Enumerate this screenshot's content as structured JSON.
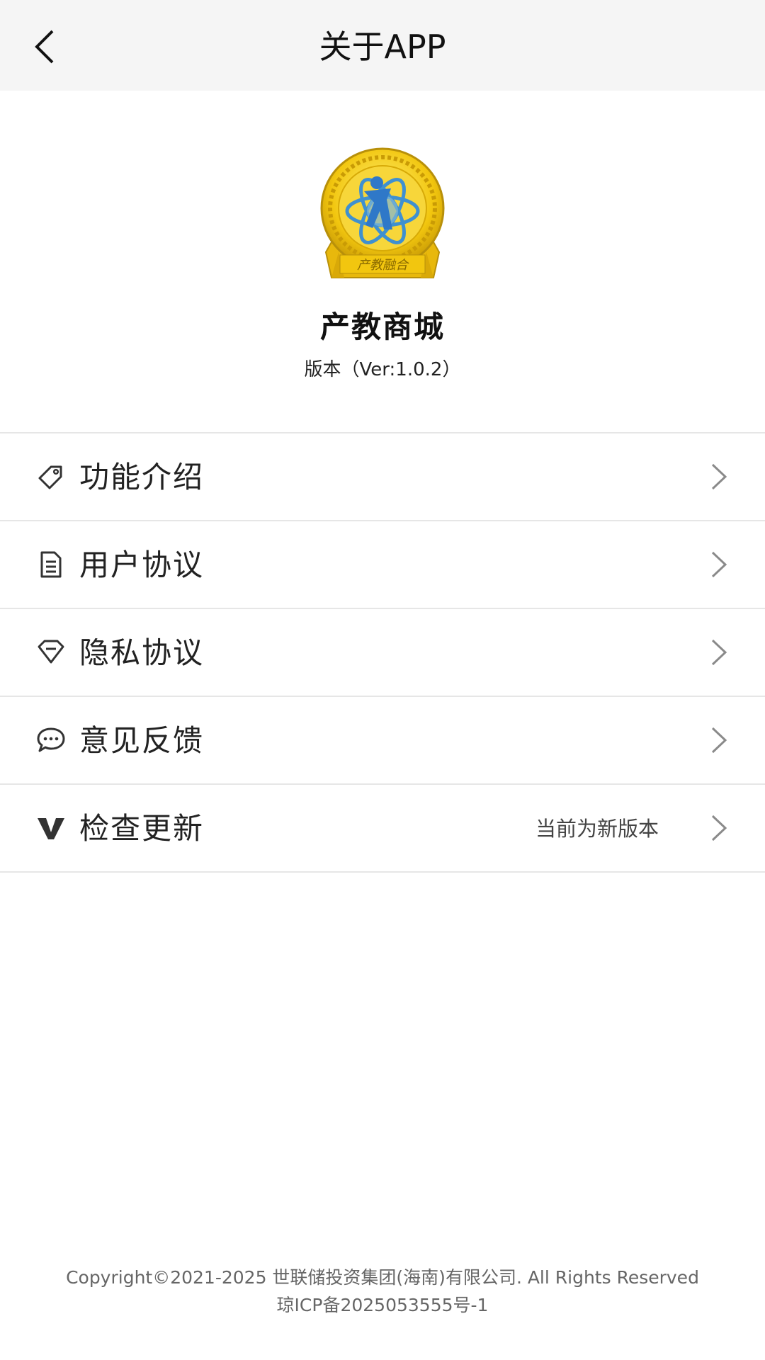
{
  "header": {
    "title": "关于APP",
    "back_icon": "chevron-left-icon"
  },
  "app": {
    "name": "产教商城",
    "version": "版本（Ver:1.0.2）",
    "logo": {
      "text": "产教融合",
      "colors": {
        "gold": "#f2c60f",
        "blue": "#2f78c8"
      }
    }
  },
  "menu": {
    "items": [
      {
        "label": "功能介绍",
        "icon": "tag-icon"
      },
      {
        "label": "用户协议",
        "icon": "document-icon"
      },
      {
        "label": "隐私协议",
        "icon": "diamond-icon"
      },
      {
        "label": "意见反馈",
        "icon": "chat-bubble-icon"
      },
      {
        "label": "检查更新",
        "icon": "v-letter-icon",
        "value": "当前为新版本"
      }
    ]
  },
  "footer": {
    "copyright": "Copyright©2021-2025 世联储投资集团(海南)有限公司. All Rights Reserved",
    "icp": "琼ICP备2025053555号-1"
  },
  "colors": {
    "header_bg": "#f5f5f5",
    "divider": "#e6e6e6",
    "chevron": "#8a8a8a"
  }
}
